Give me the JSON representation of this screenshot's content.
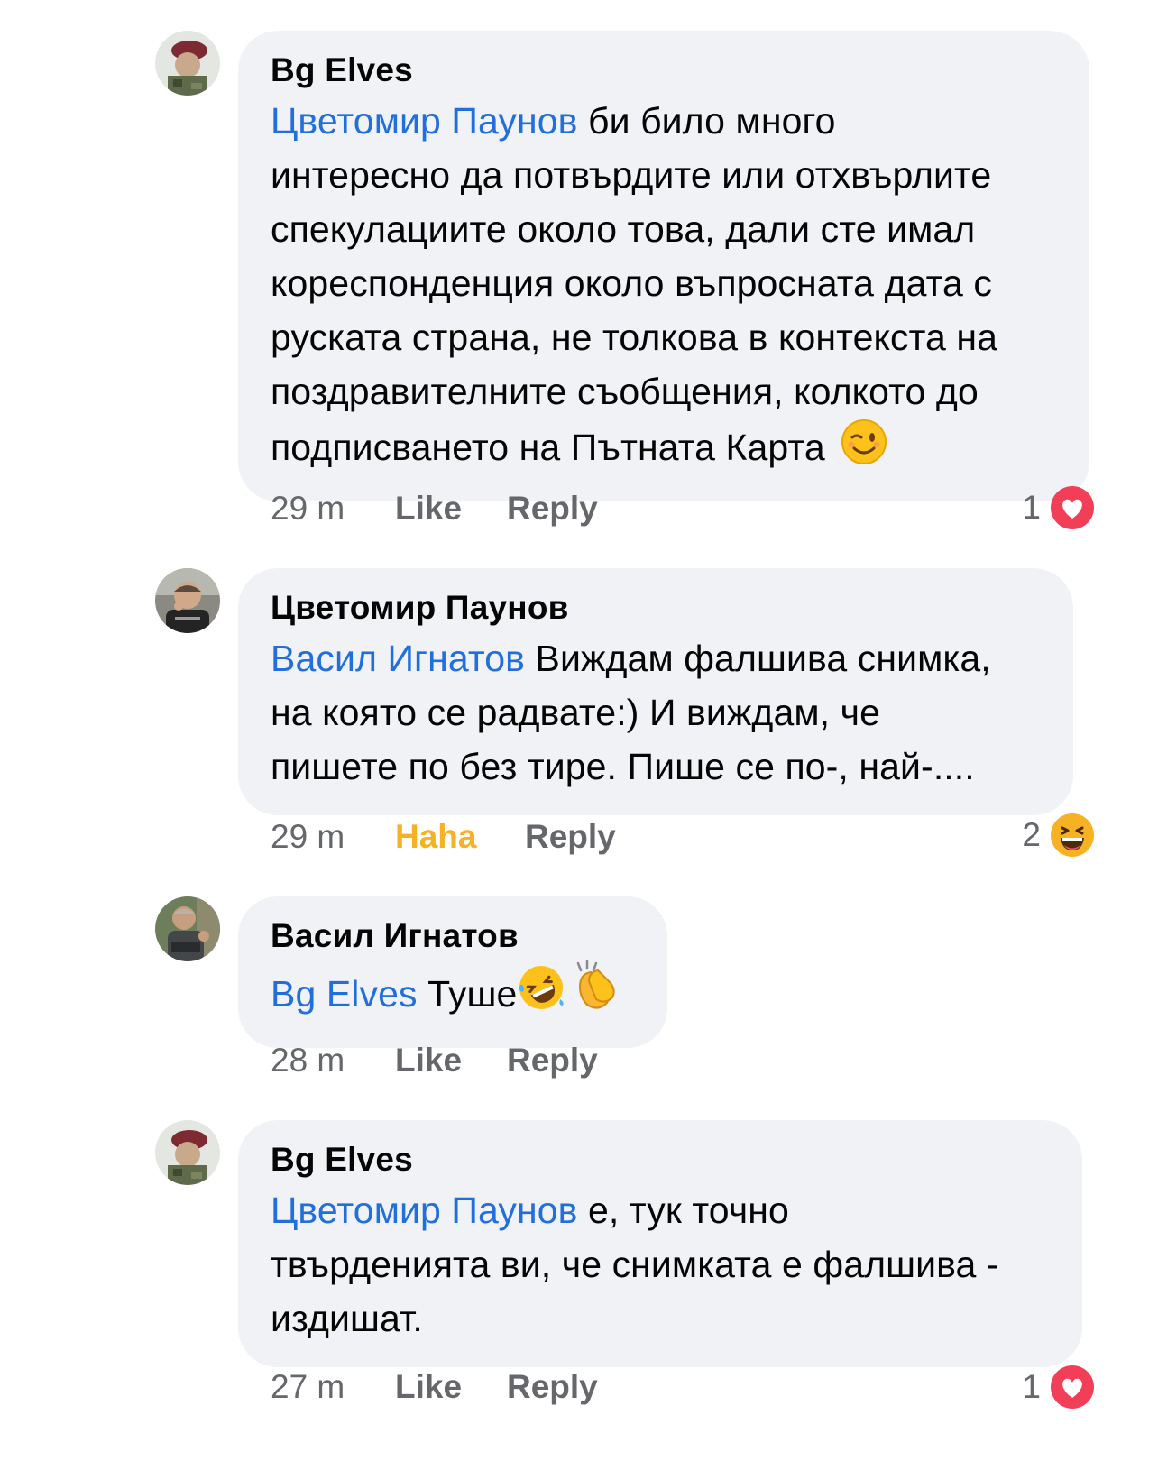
{
  "comments": [
    {
      "author": "Bg Elves",
      "mention": "Цветомир Паунов",
      "lines": [
        " би било много",
        "интересно да потвърдите или отхвърлите",
        "спекулациите около това, дали сте имал",
        "кореспонденция около въпросната дата с",
        "руската страна, не толкова в контекста на",
        "поздравителните съобщения, колкото до",
        "подписването на Пътната Карта"
      ],
      "emoji": "wink-emoji",
      "time": "29 m",
      "like_label": "Like",
      "reply_label": "Reply",
      "reaction_count": "1",
      "reaction_icon": "heart-reaction-icon"
    },
    {
      "author": "Цветомир Паунов",
      "mention": "Васил Игнатов",
      "lines": [
        " Виждам фалшива снимка,",
        "на която се радвате:) И виждам, че",
        "пишете по без тире. Пише се по-, най-...."
      ],
      "time": "29 m",
      "like_label": "Haha",
      "reply_label": "Reply",
      "reaction_count": "2",
      "reaction_icon": "haha-reaction-icon"
    },
    {
      "author": "Васил Игнатов",
      "mention": "Bg Elves",
      "lines": [
        " Туше"
      ],
      "emojis": [
        "rofl-emoji",
        "clapping-hands-emoji"
      ],
      "time": "28 m",
      "like_label": "Like",
      "reply_label": "Reply"
    },
    {
      "author": "Bg Elves",
      "mention": "Цветомир Паунов",
      "lines": [
        " е, тук точно",
        "твърденията ви, че снимката е фалшива -",
        "издишат."
      ],
      "time": "27 m",
      "like_label": "Like",
      "reply_label": "Reply",
      "reaction_count": "1",
      "reaction_icon": "heart-reaction-icon"
    }
  ],
  "colors": {
    "bubble": "#f0f2f5",
    "mention": "#216fdb",
    "meta": "#65676b",
    "haha": "#f7b125",
    "heart": "#f33e58"
  }
}
